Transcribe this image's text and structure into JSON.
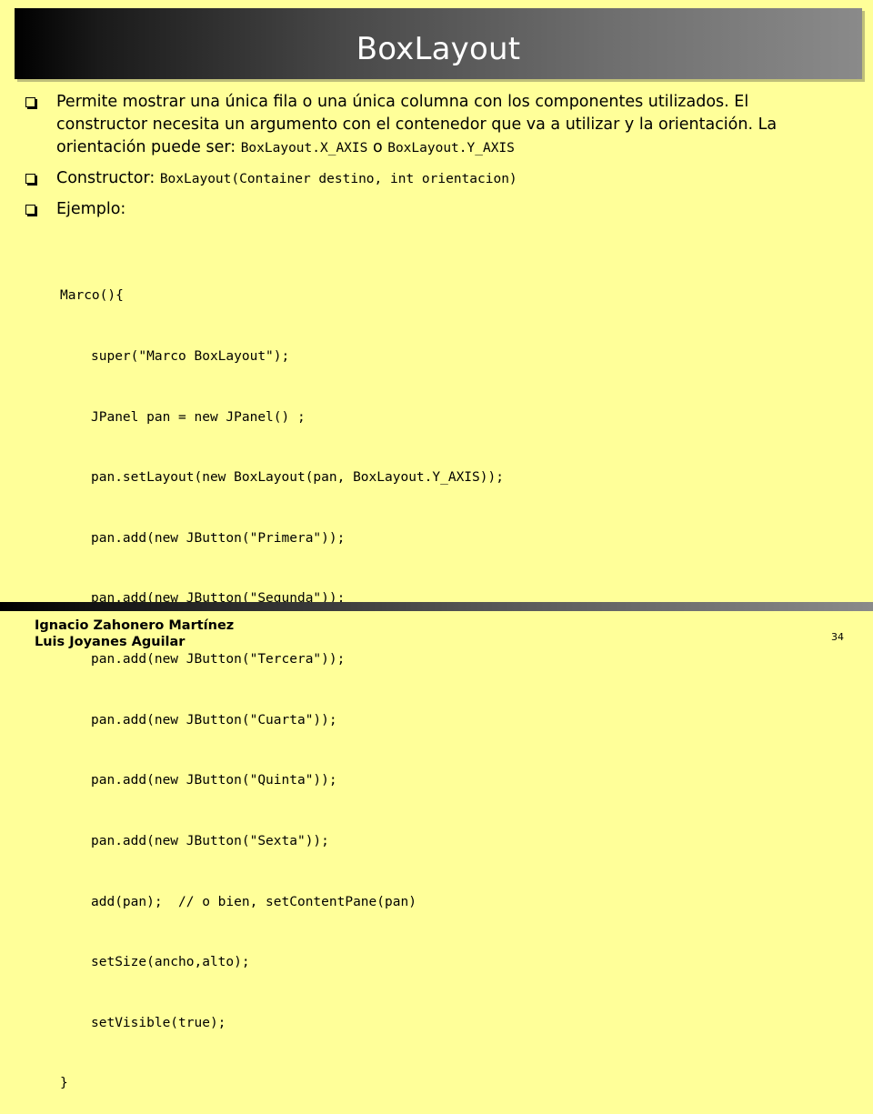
{
  "slide": {
    "title": "BoxLayout",
    "bullets": {
      "b1_text": "Permite mostrar una única fila o una única  columna con los componentes utilizados. El constructor necesita un argumento con el contenedor que va a utilizar y la orientación. La orientación puede ser: ",
      "b1_code1": "BoxLayout.X_AXIS",
      "b1_or": " o ",
      "b1_code2": "BoxLayout.Y_AXIS",
      "b2_text": "Constructor: ",
      "b2_code": "BoxLayout(Container destino, int orientacion)",
      "b3_text": "Ejemplo:"
    },
    "code_lines": [
      "Marco(){",
      "super(\"Marco BoxLayout\");",
      "JPanel pan = new JPanel() ;",
      "pan.setLayout(new BoxLayout(pan, BoxLayout.Y_AXIS));",
      "pan.add(new JButton(\"Primera\"));",
      "pan.add(new JButton(\"Segunda\"));",
      "pan.add(new JButton(\"Tercera\"));",
      "pan.add(new JButton(\"Cuarta\"));",
      "pan.add(new JButton(\"Quinta\"));",
      "pan.add(new JButton(\"Sexta\"));",
      "add(pan);  // o bien, setContentPane(pan)",
      "setSize(ancho,alto);",
      "setVisible(true);",
      "}"
    ],
    "footer": {
      "author1": "Ignacio Zahonero Martínez",
      "author2": "Luis Joyanes Aguilar",
      "page_number": "34"
    },
    "colors": {
      "background": "#FFFF99",
      "title_bar_start": "#000000",
      "title_bar_end": "#8A8A8A",
      "title_text": "#FFFFFF"
    }
  }
}
